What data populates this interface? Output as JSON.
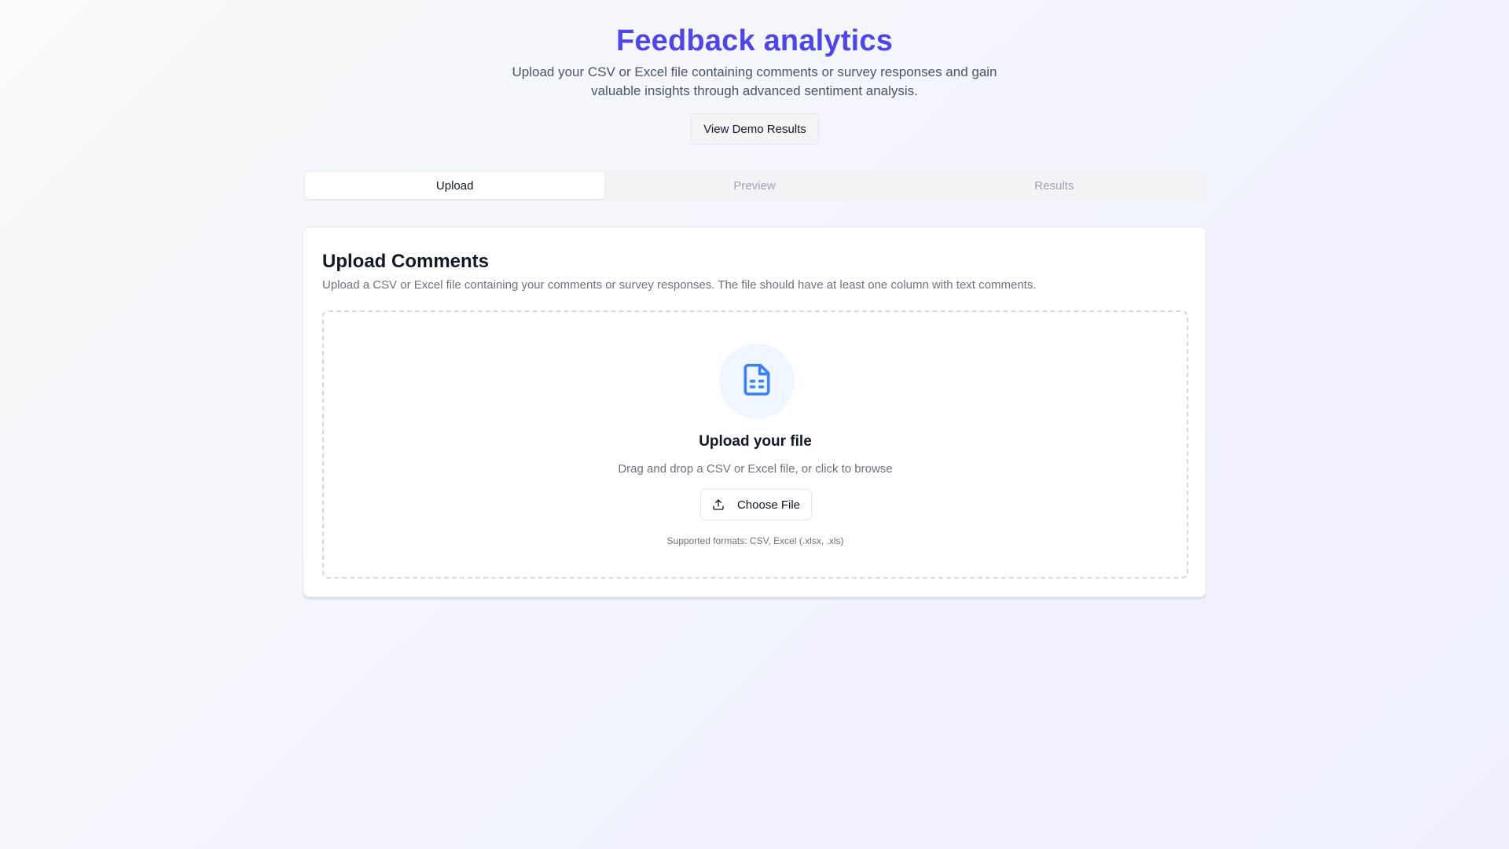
{
  "header": {
    "title": "Feedback analytics",
    "subtitle": "Upload your CSV or Excel file containing comments or survey responses and gain valuable insights through advanced sentiment analysis.",
    "demo_button": "View Demo Results"
  },
  "tabs": [
    {
      "label": "Upload",
      "active": true
    },
    {
      "label": "Preview",
      "active": false
    },
    {
      "label": "Results",
      "active": false
    }
  ],
  "card": {
    "title": "Upload Comments",
    "description": "Upload a CSV or Excel file containing your comments or survey responses. The file should have at least one column with text comments."
  },
  "dropzone": {
    "icon": "file-spreadsheet-icon",
    "title": "Upload your file",
    "description": "Drag and drop a CSV or Excel file, or click to browse",
    "button_label": "Choose File",
    "button_icon": "upload-icon",
    "formats": "Supported formats: CSV, Excel (.xlsx, .xls)"
  },
  "colors": {
    "accent": "#4f46e5",
    "icon_blue": "#3b82f6",
    "icon_bg": "#eff6ff"
  }
}
